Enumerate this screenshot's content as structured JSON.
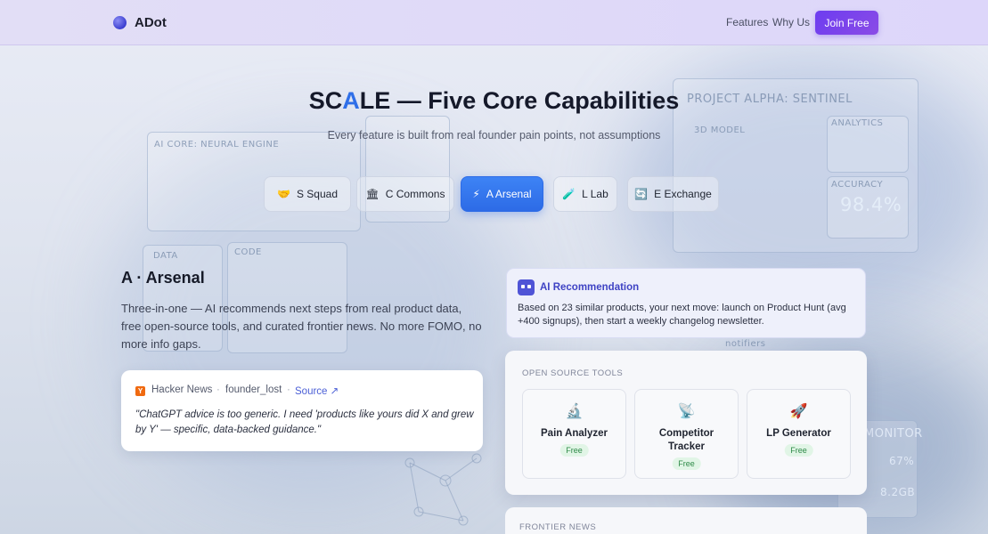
{
  "nav": {
    "logo": "ADot",
    "links": [
      "Features",
      "Why Us"
    ],
    "cta": "Join Free"
  },
  "hero": {
    "title_pre": "SC",
    "title_accent": "A",
    "title_post": "LE — Five Core Capabilities",
    "subtitle": "Every feature is built from real founder pain points, not assumptions"
  },
  "tabs": [
    {
      "icon": "🤝",
      "label": "S Squad"
    },
    {
      "icon": "🏛",
      "label": "C Commons"
    },
    {
      "icon": "⚡",
      "label": "A Arsenal",
      "active": true
    },
    {
      "icon": "🧪",
      "label": "L Lab"
    },
    {
      "icon": "🔄",
      "label": "E Exchange"
    }
  ],
  "section": {
    "title": "A · Arsenal",
    "description": "Three-in-one — AI recommends next steps from real product data, free open-source tools, and curated frontier news. No more FOMO, no more info gaps."
  },
  "quote": {
    "badge": "Y",
    "source": "Hacker News",
    "separator": "·",
    "user": "founder_lost",
    "link": "Source ↗",
    "text": "\"ChatGPT advice is too generic. I need 'products like yours did X and grew by Y' — specific, data-backed guidance.\""
  },
  "ai": {
    "title": "AI Recommendation",
    "text": "Based on 23 similar products, your next move: launch on Product Hunt (avg +400 signups), then start a weekly changelog newsletter."
  },
  "tools": {
    "heading": "OPEN SOURCE TOOLS",
    "items": [
      {
        "icon": "🔬",
        "name": "Pain Analyzer",
        "badge": "Free"
      },
      {
        "icon": "📡",
        "name": "Competitor Tracker",
        "badge": "Free"
      },
      {
        "icon": "🚀",
        "name": "LP Generator",
        "badge": "Free"
      }
    ]
  },
  "news": {
    "heading": "FRONTIER NEWS"
  },
  "background_hud": {
    "labels": [
      "PROJECT ALPHA: SENTINEL",
      "AI CORE: NEURAL ENGINE",
      "ANALYTICS",
      "ACCURACY",
      "98.4%",
      "3D MODEL",
      "CODE",
      "DATA",
      "MONITOR",
      "67%",
      "8.2GB",
      "notifiers"
    ]
  },
  "colors": {
    "accent": "#2f6fe8",
    "brand": "#6d3df0",
    "free_badge": "#2e8a48"
  }
}
